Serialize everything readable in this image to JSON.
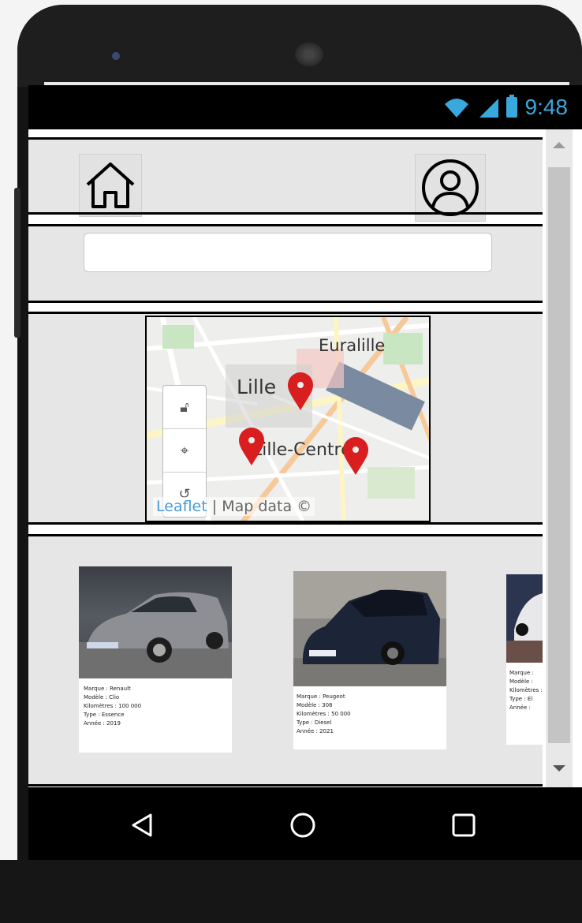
{
  "status_bar": {
    "time": "9:48",
    "icons": [
      "wifi-icon",
      "signal-icon",
      "battery-icon"
    ]
  },
  "header": {
    "home_icon": "home-icon",
    "profile_icon": "user-circle-icon"
  },
  "search": {
    "value": "",
    "placeholder": ""
  },
  "map": {
    "labels": {
      "city": "Lille",
      "district1": "Euralille",
      "district2": "Lille-Centre"
    },
    "controls": [
      "unlock-icon",
      "locate-icon",
      "reset-icon"
    ],
    "attribution": {
      "leaflet": "Leaflet",
      "separator": " | ",
      "data": "Map data ©"
    },
    "marker_color": "#d81e1e"
  },
  "cars": [
    {
      "lines": [
        "Marque : Renault",
        "Modèle : Clio",
        "Kilomètres : 100 000",
        "Type : Essence",
        "Année : 2019"
      ]
    },
    {
      "lines": [
        "Marque : Peugeot",
        "Modèle : 308",
        "Kilomètres : 50 000",
        "Type : Diesel",
        "Année : 2021"
      ]
    },
    {
      "lines": [
        "Marque :",
        "Modèle :",
        "Kilomètres :",
        "Type : El",
        "Année :"
      ]
    }
  ],
  "navigation": [
    "back-icon",
    "home-circle-icon",
    "recents-icon"
  ],
  "colors": {
    "accent_status": "#39a9dd",
    "section_bg": "#e6e6e6",
    "leaflet_link": "#4a9ad8"
  }
}
